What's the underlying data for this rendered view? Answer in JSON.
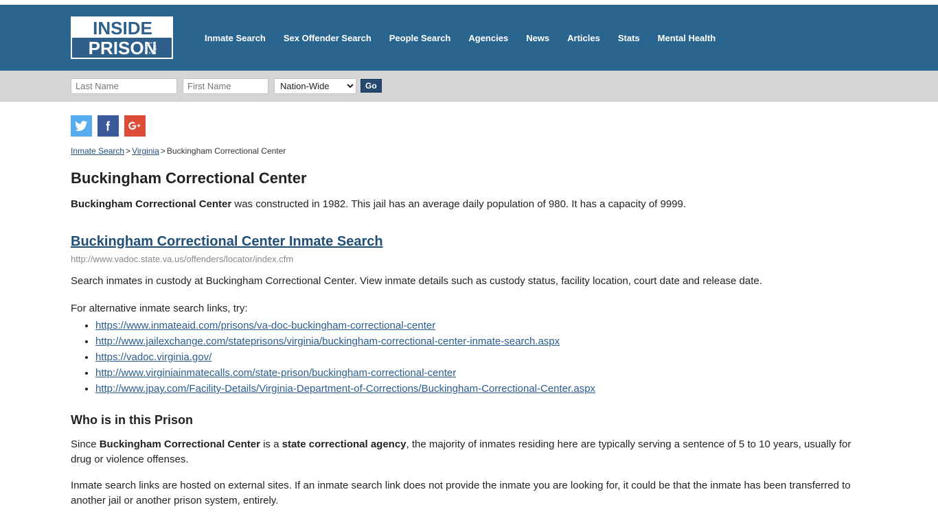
{
  "header": {
    "logo": {
      "top_text": "INSIDE",
      "bottom_text": "PRISON",
      "icon": "gear-icon"
    },
    "nav": [
      {
        "label": "Inmate Search"
      },
      {
        "label": "Sex Offender Search"
      },
      {
        "label": "People Search"
      },
      {
        "label": "Agencies"
      },
      {
        "label": "News"
      },
      {
        "label": "Articles"
      },
      {
        "label": "Stats"
      },
      {
        "label": "Mental Health"
      }
    ],
    "bg_color": "#2a6590"
  },
  "search": {
    "last_name_placeholder": "Last Name",
    "last_name_value": "",
    "first_name_placeholder": "First Name",
    "first_name_value": "",
    "scope_selected": "Nation-Wide",
    "scope_options": [
      "Nation-Wide"
    ],
    "go_label": "Go",
    "go_color": "#26486e"
  },
  "social": [
    {
      "name": "twitter",
      "label": "Twitter",
      "color": "#55acee"
    },
    {
      "name": "facebook",
      "label": "Facebook",
      "color": "#3b5998"
    },
    {
      "name": "google-plus",
      "label": "Google Plus",
      "color": "#dd4b39"
    }
  ],
  "breadcrumb": {
    "item1": "Inmate Search",
    "sep1": ">",
    "item2": "Virginia",
    "sep2": ">",
    "current": "Buckingham Correctional Center"
  },
  "main": {
    "page_title": "Buckingham Correctional Center",
    "intro_bold": "Buckingham Correctional Center",
    "intro_rest": " was constructed in 1982. This jail has an average daily population of 980. It has a capacity of 9999.",
    "search_link_label": "Buckingham Correctional Center Inmate Search",
    "search_link_url": "http://www.vadoc.state.va.us/offenders/locator/index.cfm",
    "search_description": "Search inmates in custody at Buckingham Correctional Center. View inmate details such as custody status, facility location, court date and release date.",
    "alt_intro": "For alternative inmate search links, try:",
    "alt_links": [
      "https://www.inmateaid.com/prisons/va-doc-buckingham-correctional-center",
      "http://www.jailexchange.com/stateprisons/virginia/buckingham-correctional-center-inmate-search.aspx",
      "https://vadoc.virginia.gov/",
      "http://www.virginiainmatecalls.com/state-prison/buckingham-correctional-center",
      "http://www.jpay.com/Facility-Details/Virginia-Department-of-Corrections/Buckingham-Correctional-Center.aspx"
    ],
    "who_title": "Who is in this Prison",
    "who_p1_a": "Since ",
    "who_p1_b": "Buckingham Correctional Center",
    "who_p1_c": " is a ",
    "who_p1_d": "state correctional agency",
    "who_p1_e": ", the majority of inmates residing here are typically serving a sentence of 5 to 10 years, usually for drug or violence offenses.",
    "tail_paragraph": "Inmate search links are hosted on external sites. If an inmate search link does not provide the inmate you are looking for, it could be that the inmate has been transferred to another jail or another prison system, entirely."
  }
}
